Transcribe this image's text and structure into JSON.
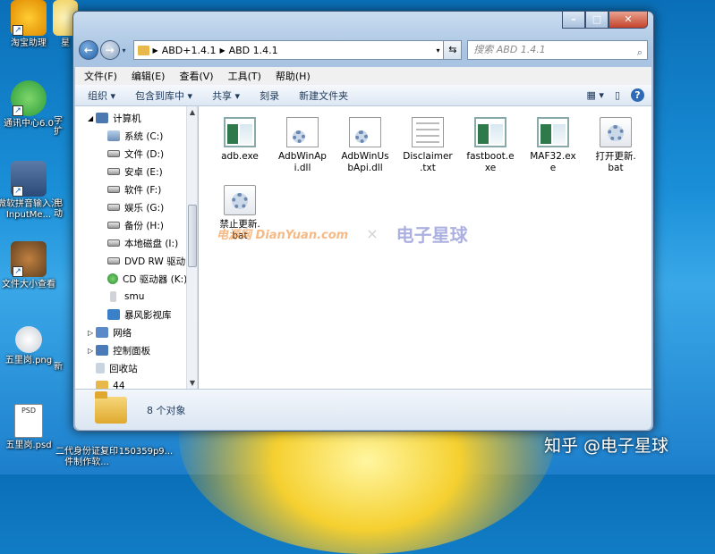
{
  "desktop": {
    "icons": [
      {
        "label": "淘宝助理"
      },
      {
        "label": "星"
      },
      {
        "label": "通讯中心6.0"
      },
      {
        "label": "字扩"
      },
      {
        "label": "微软拼音输入法InputMe..."
      },
      {
        "label": "电动"
      },
      {
        "label": "文件大小查看"
      },
      {
        "label": "五里岗.png"
      },
      {
        "label": "新"
      },
      {
        "label": "五里岗.psd"
      },
      {
        "label": "二代身份证复印件制作软..."
      },
      {
        "label": "150359p9..."
      }
    ],
    "psd_tag": "PSD"
  },
  "window": {
    "address": {
      "seg1": "ABD+1.4.1",
      "seg2": "ABD 1.4.1"
    },
    "search_placeholder": "搜索 ABD 1.4.1",
    "menu": [
      "文件(F)",
      "编辑(E)",
      "查看(V)",
      "工具(T)",
      "帮助(H)"
    ],
    "commands": [
      "组织 ▾",
      "包含到库中 ▾",
      "共享 ▾",
      "刻录",
      "新建文件夹"
    ],
    "tree": [
      {
        "label": "计算机",
        "icon": "computer-icon"
      },
      {
        "label": "系统 (C:)",
        "icon": "drive-icon"
      },
      {
        "label": "文件 (D:)",
        "icon": "drive-icon"
      },
      {
        "label": "安卓 (E:)",
        "icon": "drive-icon"
      },
      {
        "label": "软件 (F:)",
        "icon": "drive-icon"
      },
      {
        "label": "娱乐 (G:)",
        "icon": "drive-icon"
      },
      {
        "label": "备份 (H:)",
        "icon": "drive-icon"
      },
      {
        "label": "本地磁盘 (I:)",
        "icon": "drive-icon"
      },
      {
        "label": "DVD RW 驱动",
        "icon": "dvd-icon"
      },
      {
        "label": "CD 驱动器 (K:)",
        "icon": "cd-icon"
      },
      {
        "label": "smu",
        "icon": "phone-icon"
      },
      {
        "label": "暴风影视库",
        "icon": "media-icon"
      },
      {
        "label": "网络",
        "icon": "network-icon"
      },
      {
        "label": "控制面板",
        "icon": "control-panel-icon"
      },
      {
        "label": "回收站",
        "icon": "recycle-bin-icon"
      },
      {
        "label": "44",
        "icon": "folder-icon"
      }
    ],
    "files": [
      {
        "l1": "adb.exe",
        "l2": "",
        "type": "exe"
      },
      {
        "l1": "AdbWinAp",
        "l2": "i.dll",
        "type": "dll"
      },
      {
        "l1": "AdbWinUs",
        "l2": "bApi.dll",
        "type": "dll"
      },
      {
        "l1": "Disclaimer",
        "l2": ".txt",
        "type": "txt"
      },
      {
        "l1": "fastboot.e",
        "l2": "xe",
        "type": "exe"
      },
      {
        "l1": "MAF32.ex",
        "l2": "e",
        "type": "exe"
      },
      {
        "l1": "打开更新.",
        "l2": "bat",
        "type": "bat"
      },
      {
        "l1": "禁止更新.",
        "l2": "bat",
        "type": "bat"
      }
    ],
    "status_text": "8 个对象",
    "watermark": {
      "left": "电源网 DianYuan.com",
      "x": "×",
      "right": "电子星球"
    }
  },
  "overlay_text": "知乎 @电子星球"
}
